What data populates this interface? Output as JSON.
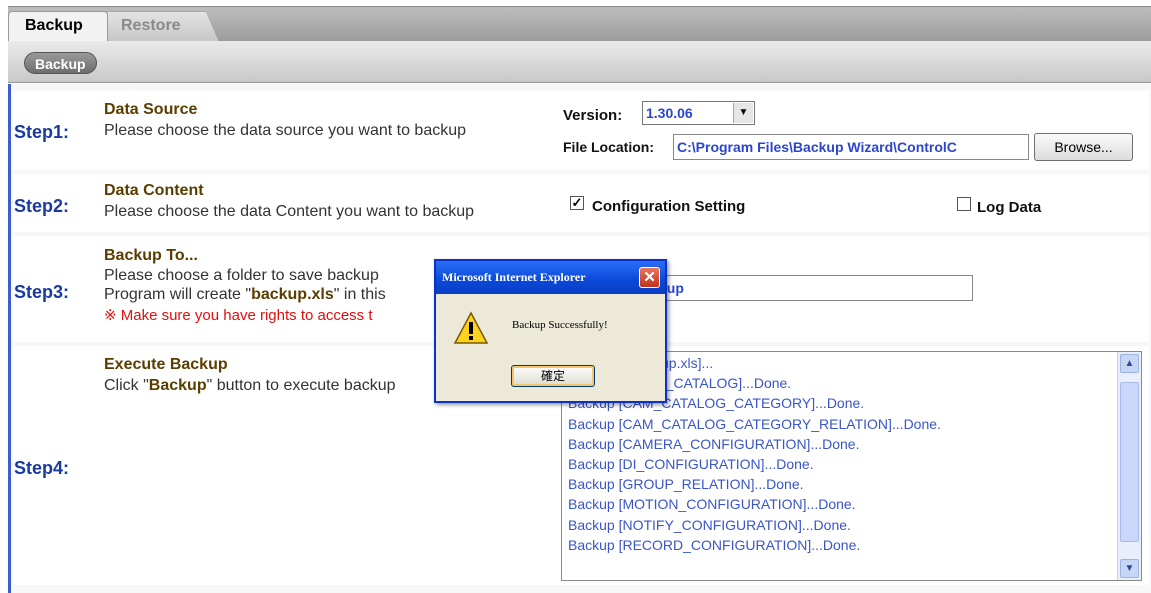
{
  "page_heading_partial": "",
  "tabs": [
    {
      "label": "Backup",
      "active": true
    },
    {
      "label": "Restore",
      "active": false
    }
  ],
  "subbar": {
    "pill_label": "Backup"
  },
  "steps": {
    "step1": {
      "label": "Step1:",
      "title": "Data Source",
      "desc": "Please choose the data source you want to backup",
      "version_label": "Version:",
      "version_value": "1.30.06",
      "file_location_label": "File Location:",
      "file_location_value": "C:\\Program Files\\Backup Wizard\\ControlC",
      "browse_label": "Browse..."
    },
    "step2": {
      "label": "Step2:",
      "title": "Data Content",
      "desc": "Please choose the data Content you want to backup",
      "config_label": "Configuration Setting",
      "config_checked": true,
      "log_label": "Log Data",
      "log_checked": false
    },
    "step3": {
      "label": "Step3:",
      "title": "Backup To...",
      "desc_line1": "Please choose a folder to save backup",
      "desc_line2_prefix": "Program will create \"",
      "desc_line2_bold": "backup.xls",
      "desc_line2_suffix": "\" in this",
      "warning": "※ Make sure you have rights to access t",
      "path_value_visible": "kup"
    },
    "step4": {
      "label": "Step4:",
      "title": "Execute Backup",
      "desc_prefix": "Click \"",
      "desc_bold": "Backup",
      "desc_suffix": "\" button to execute backup",
      "log_lines": [
        "kup.xls]...",
        "M_CATALOG]...Done.",
        "Backup [CAM_CATALOG_CATEGORY]...Done.",
        "Backup [CAM_CATALOG_CATEGORY_RELATION]...Done.",
        "Backup [CAMERA_CONFIGURATION]...Done.",
        "Backup [DI_CONFIGURATION]...Done.",
        "Backup [GROUP_RELATION]...Done.",
        "Backup [MOTION_CONFIGURATION]...Done.",
        "Backup [NOTIFY_CONFIGURATION]...Done.",
        "Backup [RECORD_CONFIGURATION]...Done."
      ]
    }
  },
  "dialog": {
    "title": "Microsoft Internet Explorer",
    "message": "Backup Successfully!",
    "ok_label": "確定",
    "icon": "warning-icon"
  },
  "colors": {
    "accent": "#1b3aa0",
    "title_brown": "#5a3d00",
    "warning_red": "#e01010",
    "dialog_blue": "#0a48d8",
    "log_text": "#3a55c8"
  }
}
